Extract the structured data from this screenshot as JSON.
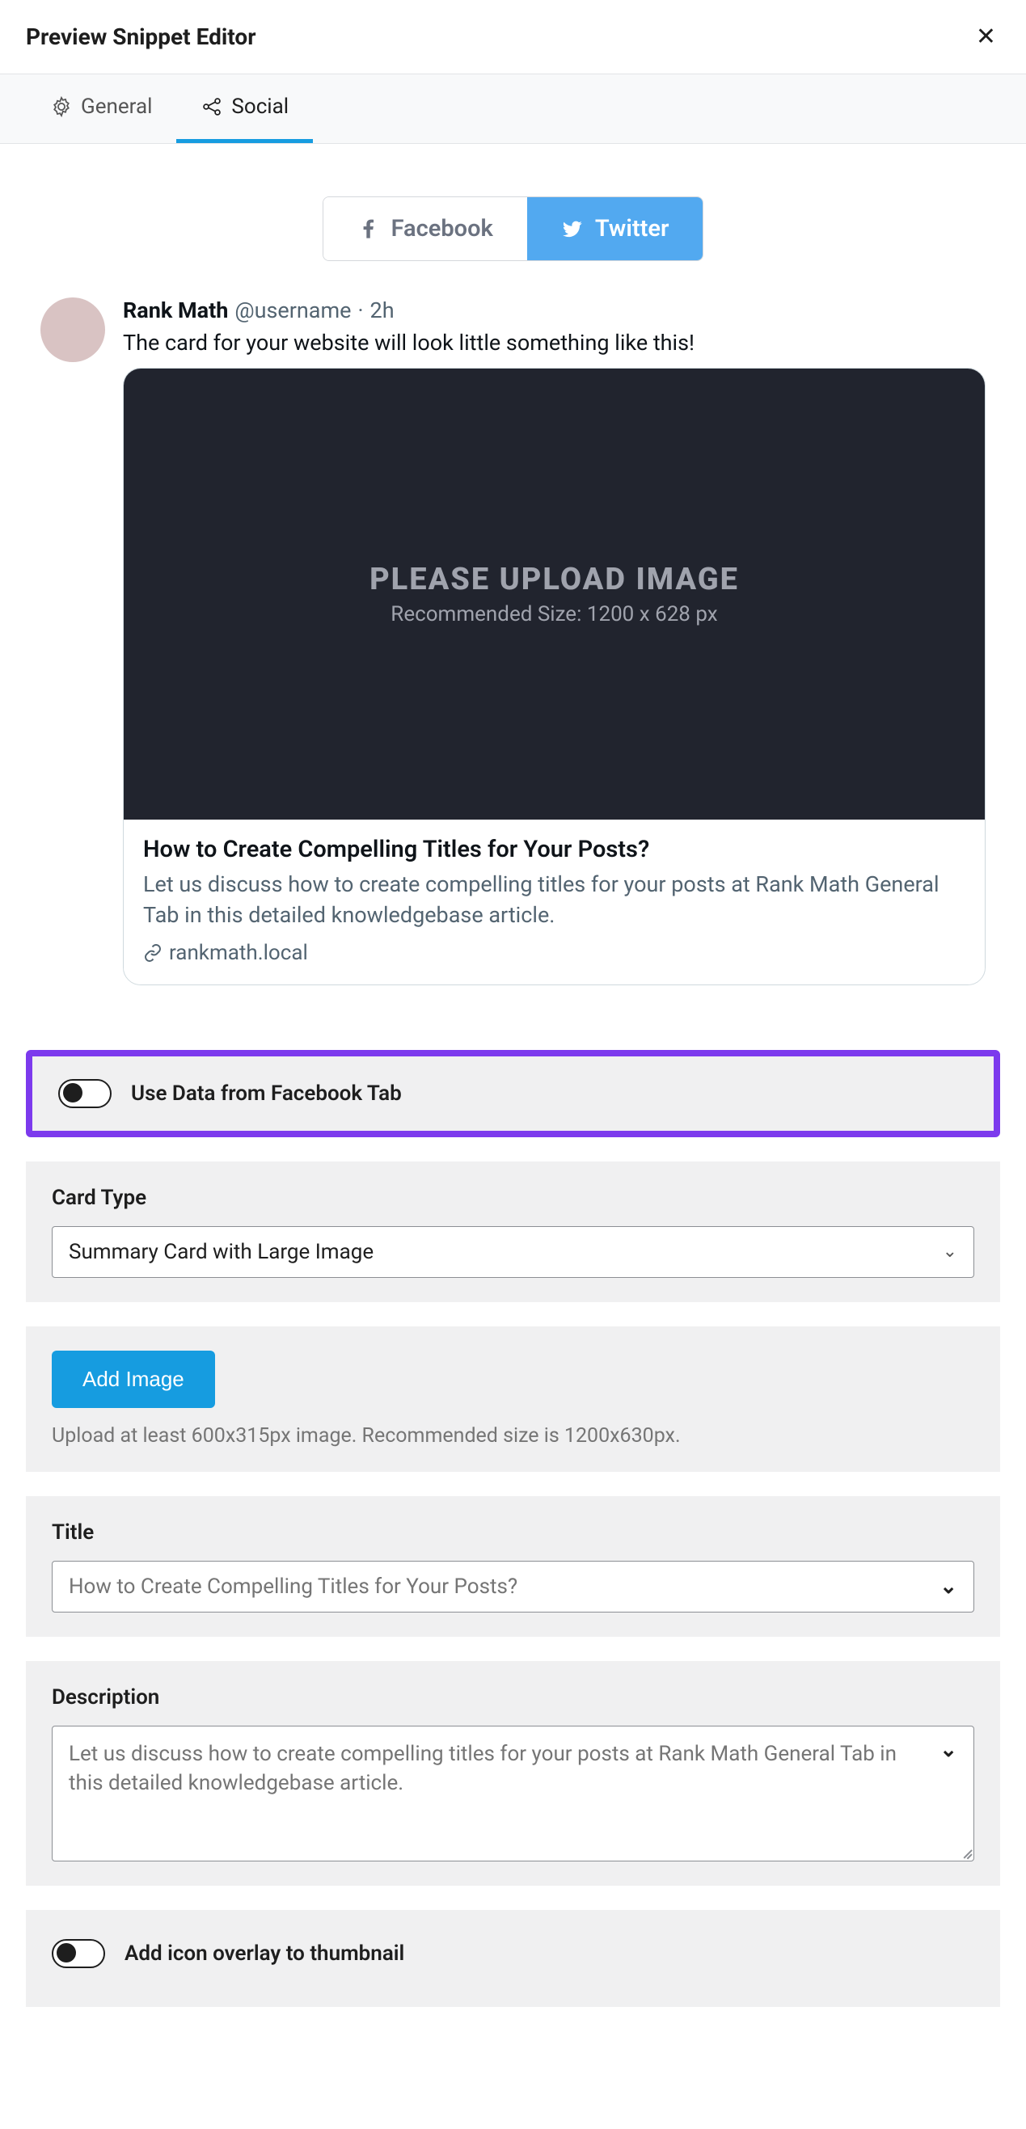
{
  "header": {
    "title": "Preview Snippet Editor"
  },
  "tabs": {
    "general": "General",
    "social": "Social"
  },
  "social_tabs": {
    "facebook": "Facebook",
    "twitter": "Twitter"
  },
  "tweet": {
    "name": "Rank Math",
    "handle": "@username",
    "time": "2h",
    "text": "The card for your website will look little something like this!",
    "upload_line1": "PLEASE UPLOAD IMAGE",
    "upload_line2": "Recommended Size: 1200 x 628 px",
    "card_title": "How to Create Compelling Titles for Your Posts?",
    "card_desc": "Let us discuss how to create compelling titles for your posts at Rank Math General Tab in this detailed knowledgebase article.",
    "card_link": "rankmath.local"
  },
  "form": {
    "use_fb": "Use Data from Facebook Tab",
    "card_type_label": "Card Type",
    "card_type_value": "Summary Card with Large Image",
    "add_image_btn": "Add Image",
    "add_image_help": "Upload at least 600x315px image. Recommended size is 1200x630px.",
    "title_label": "Title",
    "title_value": "How to Create Compelling Titles for Your Posts?",
    "desc_label": "Description",
    "desc_value": "Let us discuss how to create compelling titles for your posts at Rank Math General Tab in this detailed knowledgebase article.",
    "overlay_label": "Add icon overlay to thumbnail"
  }
}
